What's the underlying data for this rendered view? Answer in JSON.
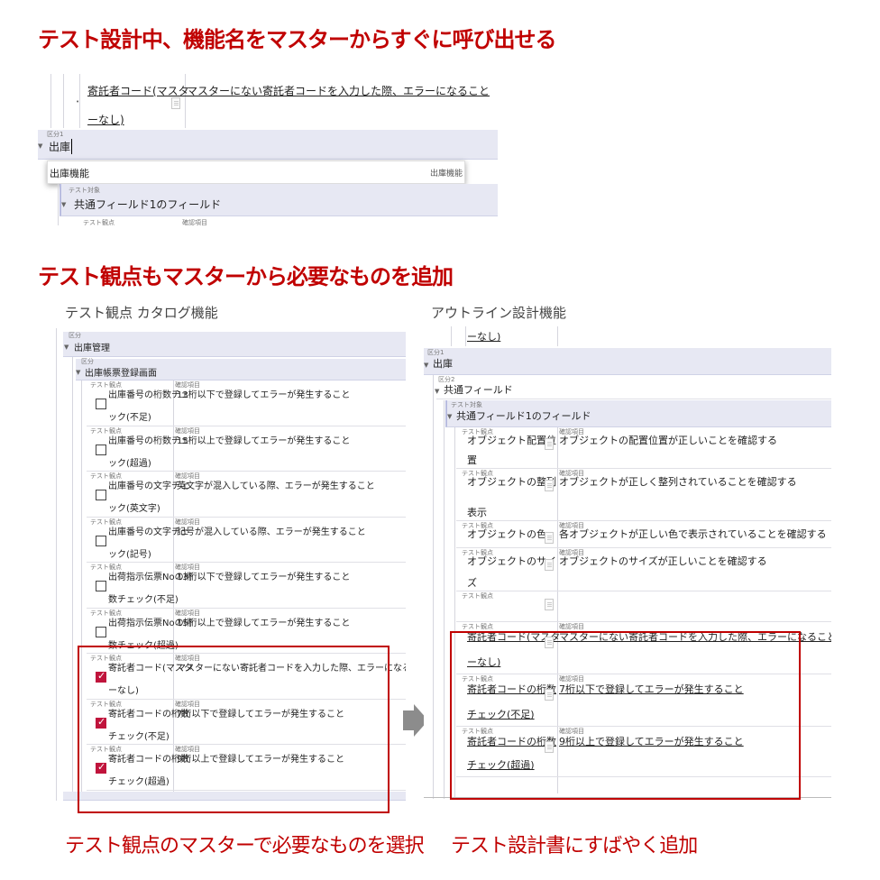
{
  "headings": {
    "h1": "テスト設計中、機能名をマスターからすぐに呼び出せる",
    "h2": "テスト観点もマスターから必要なものを追加"
  },
  "top_shot": {
    "row_name_1": "寄託者コード(マスタ",
    "row_name_2": "ーなし)",
    "row_desc": "マスターにない寄託者コードを入力した際、エラーになること",
    "section_label": "区分1",
    "input_value": "出庫",
    "suggestion_left": "出庫機能",
    "suggestion_right": "出庫機能",
    "target_label": "テスト対象",
    "target_value": "共通フィールド1のフィールド",
    "col_label_a": "テスト観点",
    "col_label_b": "確認項目"
  },
  "left_caption": "テスト観点 カタログ機能",
  "right_caption": "アウトライン設計機能",
  "left_panel": {
    "kubun_label": "区分",
    "group1": "出庫管理",
    "kubun_label2": "区分",
    "group2": "出庫帳票登録画面",
    "col_label_a": "テスト観点",
    "col_label_b": "確認項目",
    "rows": [
      {
        "name1": "出庫番号の桁数チェ",
        "name2": "ック(不足)",
        "desc": "13桁以下で登録してエラーが発生すること",
        "checked": false
      },
      {
        "name1": "出庫番号の桁数チェ",
        "name2": "ック(超過)",
        "desc": "15桁以上で登録してエラーが発生すること",
        "checked": false
      },
      {
        "name1": "出庫番号の文字チェ",
        "name2": "ック(英文字)",
        "desc": "英文字が混入している際、エラーが発生すること",
        "checked": false
      },
      {
        "name1": "出庫番号の文字チェ",
        "name2": "ック(記号)",
        "desc": "記号が混入している際、エラーが発生すること",
        "checked": false
      },
      {
        "name1": "出荷指示伝票Noの桁",
        "name2": "数チェック(不足)",
        "desc": "13桁以下で登録してエラーが発生すること",
        "checked": false
      },
      {
        "name1": "出荷指示伝票Noの桁",
        "name2": "数チェック(超過)",
        "desc": "15桁以上で登録してエラーが発生すること",
        "checked": false
      },
      {
        "name1": "寄託者コード(マスタ",
        "name2": "ーなし)",
        "desc": "マスターにない寄託者コードを入力した際、エラーになること",
        "checked": true
      },
      {
        "name1": "寄託者コードの桁数",
        "name2": "チェック(不足)",
        "desc": "7桁以下で登録してエラーが発生すること",
        "checked": true
      },
      {
        "name1": "寄託者コードの桁数",
        "name2": "チェック(超過)",
        "desc": "9桁以上で登録してエラーが発生すること",
        "checked": true
      }
    ]
  },
  "right_panel": {
    "top_fragment": "ーなし)",
    "kubun1_label": "区分1",
    "kubun1_value": "出庫",
    "kubun2_label": "区分2",
    "kubun2_value": "共通フィールド",
    "target_label": "テスト対象",
    "target_value": "共通フィールド1のフィールド",
    "col_label_a": "テスト観点",
    "col_label_b": "確認項目",
    "rows": [
      {
        "name1": "オブジェクト配置位",
        "name2": "置",
        "desc": "オブジェクトの配置位置が正しいことを確認する"
      },
      {
        "name1": "オブジェクトの整列",
        "name2": "表示",
        "desc": "オブジェクトが正しく整列されていることを確認する"
      },
      {
        "name1": "オブジェクトの色",
        "name2": "",
        "desc": "各オブジェクトが正しい色で表示されていることを確認する"
      },
      {
        "name1": "オブジェクトのサイ",
        "name2": "ズ",
        "desc": "オブジェクトのサイズが正しいことを確認する"
      }
    ],
    "added_rows": [
      {
        "name1": "寄託者コード(マスタ",
        "name2": "ーなし)",
        "desc": "マスターにない寄託者コードを入力した際、エラーになること"
      },
      {
        "name1": "寄託者コードの桁数",
        "name2": "チェック(不足)",
        "desc": "7桁以下で登録してエラーが発生すること"
      },
      {
        "name1": "寄託者コードの桁数",
        "name2": "チェック(超過)",
        "desc": "9桁以上で登録してエラーが発生すること"
      }
    ]
  },
  "bottom_captions": {
    "left": "テスト観点のマスターで必要なものを選択",
    "right": "テスト設計書にすばやく追加"
  },
  "colors": {
    "accent_red": "#c00000",
    "check_red": "#c0143c",
    "band": "#e7e8f3",
    "arrow_gray": "#8c8c8c"
  }
}
